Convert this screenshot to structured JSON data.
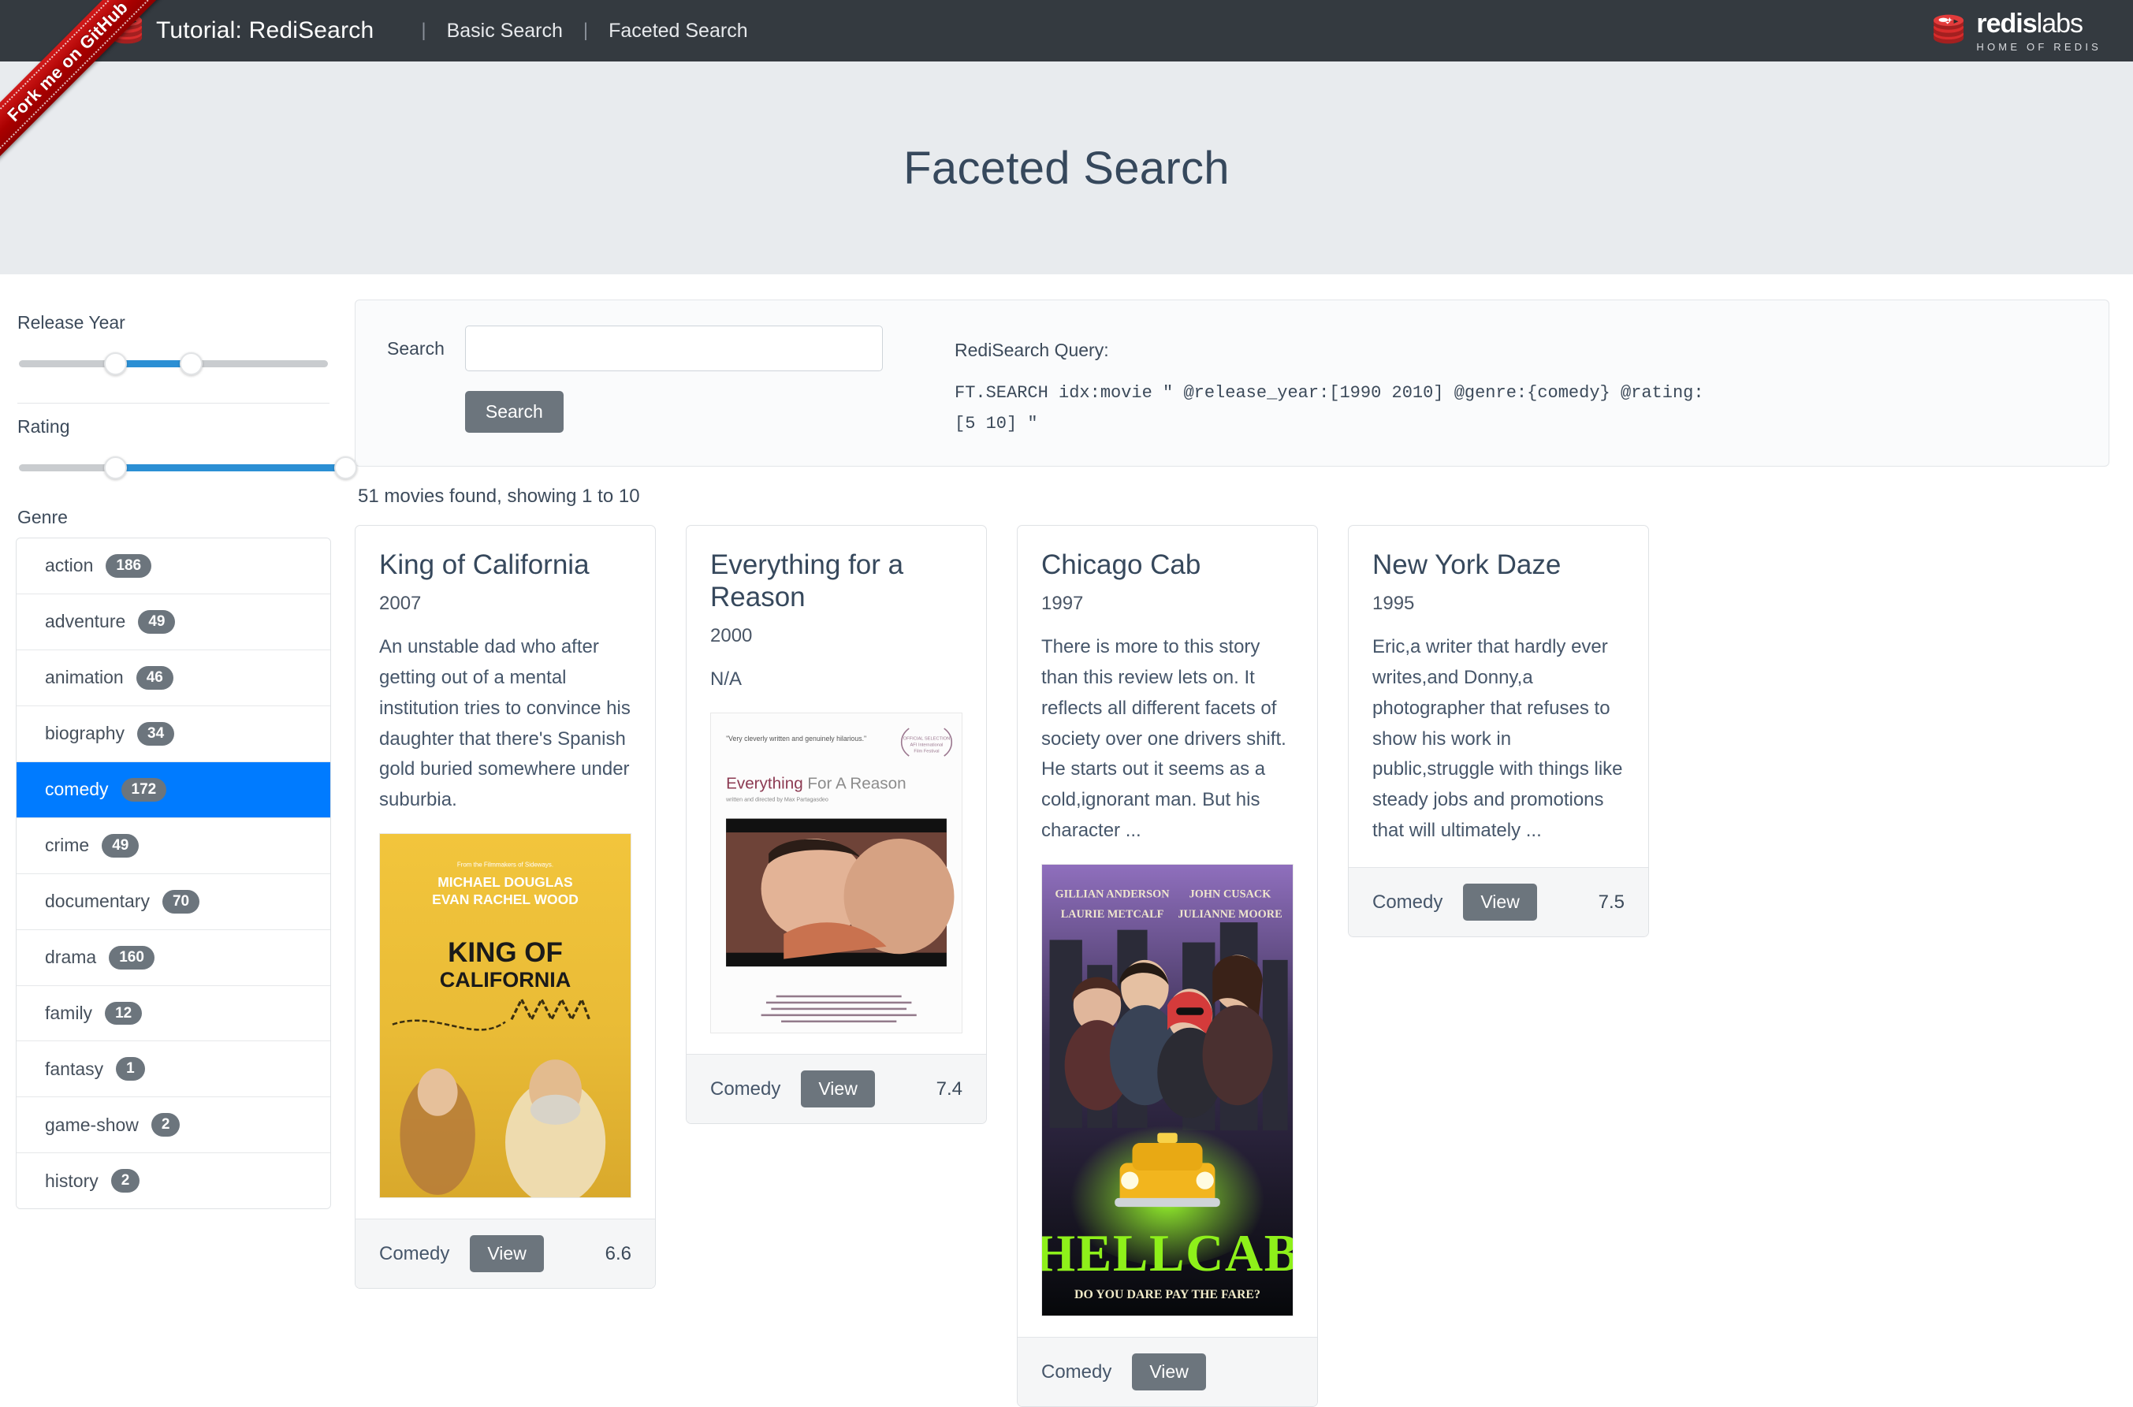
{
  "ribbon": {
    "text": "Fork me on GitHub"
  },
  "navbar": {
    "brand_title": "Tutorial: RediSearch",
    "logo_icon": "redis-stack-icon",
    "separator": "|",
    "links": [
      {
        "label": "Basic Search"
      },
      {
        "label": "Faceted Search"
      }
    ],
    "right_logo": {
      "name": "redis",
      "suffix": "labs",
      "tagline": "HOME OF REDIS"
    }
  },
  "hero": {
    "title": "Faceted Search"
  },
  "sidebar": {
    "release_year": {
      "label": "Release Year",
      "slider": {
        "min_pct": 29.5,
        "max_pct": 52.7
      }
    },
    "rating": {
      "label": "Rating",
      "slider": {
        "min_pct": 29.5,
        "max_pct": 100
      }
    },
    "genre": {
      "label": "Genre",
      "items": [
        {
          "label": "action",
          "count": "186",
          "selected": false
        },
        {
          "label": "adventure",
          "count": "49",
          "selected": false
        },
        {
          "label": "animation",
          "count": "46",
          "selected": false
        },
        {
          "label": "biography",
          "count": "34",
          "selected": false
        },
        {
          "label": "comedy",
          "count": "172",
          "selected": true
        },
        {
          "label": "crime",
          "count": "49",
          "selected": false
        },
        {
          "label": "documentary",
          "count": "70",
          "selected": false
        },
        {
          "label": "drama",
          "count": "160",
          "selected": false
        },
        {
          "label": "family",
          "count": "12",
          "selected": false
        },
        {
          "label": "fantasy",
          "count": "1",
          "selected": false
        },
        {
          "label": "game-show",
          "count": "2",
          "selected": false
        },
        {
          "label": "history",
          "count": "2",
          "selected": false
        }
      ]
    }
  },
  "search": {
    "label": "Search",
    "input_value": "",
    "input_placeholder": "",
    "button_label": "Search",
    "query_title": "RediSearch Query:",
    "query_text": "FT.SEARCH idx:movie \" @release_year:[1990 2010] @genre:{comedy} @rating:[5 10] \""
  },
  "results": {
    "count_text": "51 movies found, showing 1 to 10",
    "cards": [
      {
        "title": "King of California",
        "year": "2007",
        "description": "An unstable dad who after getting out of a mental institution tries to convince his daughter that there's Spanish gold buried somewhere under suburbia.",
        "genre": "Comedy",
        "view_label": "View",
        "rating": "6.6",
        "poster": "king-of-california-poster"
      },
      {
        "title": "Everything for a Reason",
        "year": "2000",
        "description": "N/A",
        "genre": "Comedy",
        "view_label": "View",
        "rating": "7.4",
        "poster": "everything-for-a-reason-poster"
      },
      {
        "title": "Chicago Cab",
        "year": "1997",
        "description": "There is more to this story than this review lets on. It reflects all different facets of society over one drivers shift. He starts out it seems as a cold,ignorant man. But his character ...",
        "genre": "Comedy",
        "view_label": "View",
        "rating": "",
        "poster": "hellcab-poster"
      },
      {
        "title": "New York Daze",
        "year": "1995",
        "description": "Eric,a writer that hardly ever writes,and Donny,a photographer that refuses to show his work in public,struggle with things like steady jobs and promotions that will ultimately ...",
        "genre": "Comedy",
        "view_label": "View",
        "rating": "7.5",
        "poster": ""
      }
    ]
  },
  "colors": {
    "navbar_bg": "#343a40",
    "hero_bg": "#e8ebee",
    "accent_blue": "#007bff",
    "slider_blue": "#2b8fd4",
    "badge_gray": "#6c757d",
    "ribbon_red": "#b00000"
  }
}
